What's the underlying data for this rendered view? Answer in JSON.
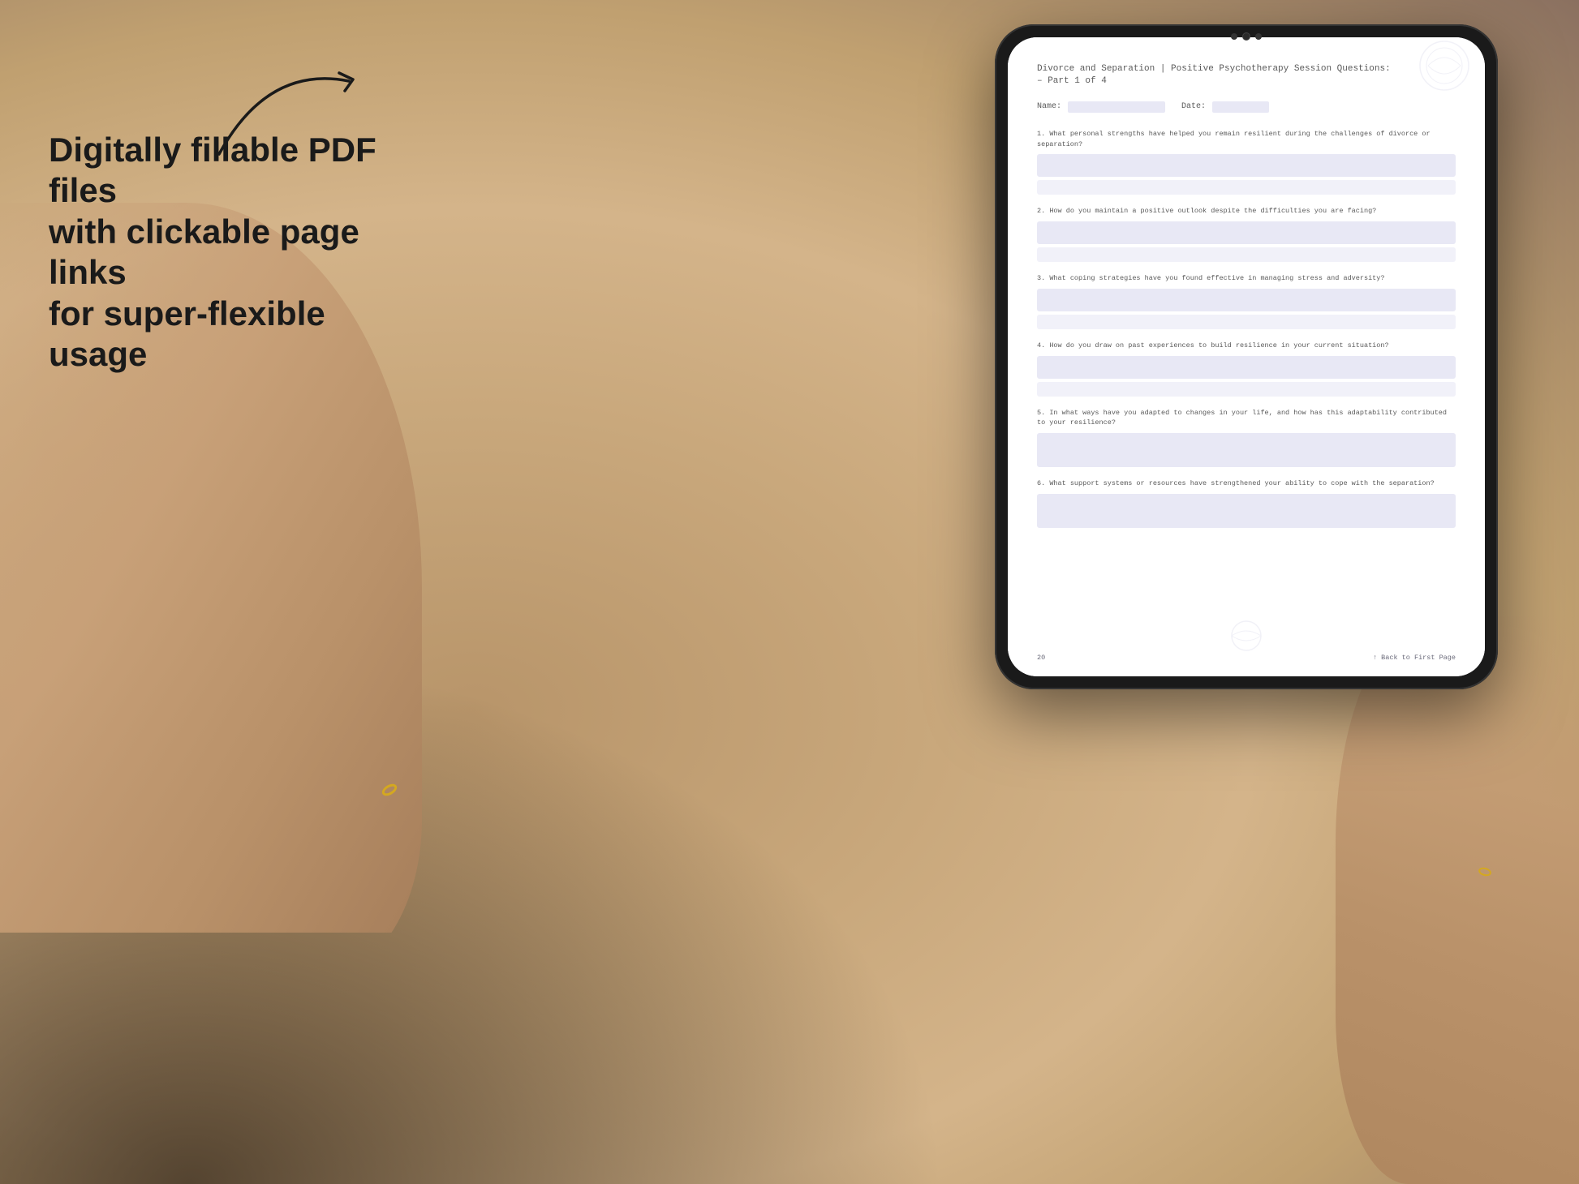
{
  "background": {
    "color_main": "#c4a882",
    "color_dark": "#3a2a1a"
  },
  "arrow": {
    "description": "curved arrow pointing right toward tablet"
  },
  "left_text": {
    "line1": "Digitally fillable PDF files",
    "line2": "with clickable page links",
    "line3": "for super-flexible usage"
  },
  "tablet": {
    "camera_dots": 3
  },
  "pdf_page": {
    "title_line1": "Divorce and Separation | Positive Psychotherapy Session Questions:",
    "title_line2": "– Part 1 of 4",
    "name_label": "Name:",
    "date_label": "Date:",
    "questions": [
      {
        "number": "1.",
        "text": "What personal strengths have helped you remain resilient during the challenges of divorce\nor separation?"
      },
      {
        "number": "2.",
        "text": "How do you maintain a positive outlook despite the difficulties you are facing?"
      },
      {
        "number": "3.",
        "text": "What coping strategies have you found effective in managing stress and adversity?"
      },
      {
        "number": "4.",
        "text": "How do you draw on past experiences to build resilience in your current situation?"
      },
      {
        "number": "5.",
        "text": "In what ways have you adapted to changes in your life, and how has this adaptability\ncontributed to your resilience?"
      },
      {
        "number": "6.",
        "text": "What support systems or resources have strengthened your ability to cope with the\nseparation?"
      }
    ],
    "footer": {
      "page_number": "20",
      "back_link": "↑ Back to First Page"
    }
  }
}
